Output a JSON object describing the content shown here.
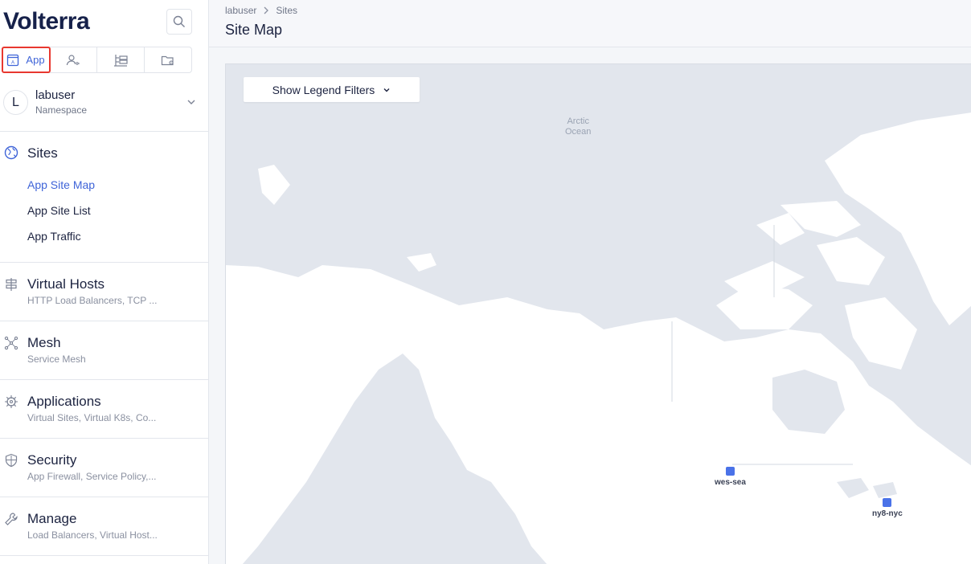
{
  "brand": {
    "name": "olterra",
    "v": "V"
  },
  "tabs": [
    {
      "label": "App",
      "icon": "app-window-icon"
    },
    {
      "label": "",
      "icon": "users-icon"
    },
    {
      "label": "",
      "icon": "tree-icon"
    },
    {
      "label": "",
      "icon": "folder-gear-icon"
    }
  ],
  "namespace": {
    "avatar": "L",
    "name": "labuser",
    "subtitle": "Namespace"
  },
  "sites": {
    "title": "Sites",
    "items": [
      "App Site Map",
      "App Site List",
      "App Traffic"
    ]
  },
  "sections": [
    {
      "title": "Virtual Hosts",
      "subtitle": "HTTP Load Balancers, TCP ..."
    },
    {
      "title": "Mesh",
      "subtitle": "Service Mesh"
    },
    {
      "title": "Applications",
      "subtitle": "Virtual Sites, Virtual K8s, Co..."
    },
    {
      "title": "Security",
      "subtitle": "App Firewall, Service Policy,..."
    },
    {
      "title": "Manage",
      "subtitle": "Load Balancers, Virtual Host..."
    }
  ],
  "breadcrumb": {
    "first": "labuser",
    "sep": ">",
    "second": "Sites"
  },
  "page": {
    "title": "Site Map"
  },
  "map": {
    "legend_button": "Show Legend Filters",
    "ocean_label_1": "Arctic",
    "ocean_label_2": "Ocean",
    "sites": [
      {
        "label": "wes-sea"
      },
      {
        "label": "ny8-nyc"
      }
    ]
  },
  "colors": {
    "accent": "#3f64d8",
    "highlight": "#e8382f",
    "site": "#4a72e8",
    "water": "#e2e6ed",
    "land": "#ffffff"
  }
}
